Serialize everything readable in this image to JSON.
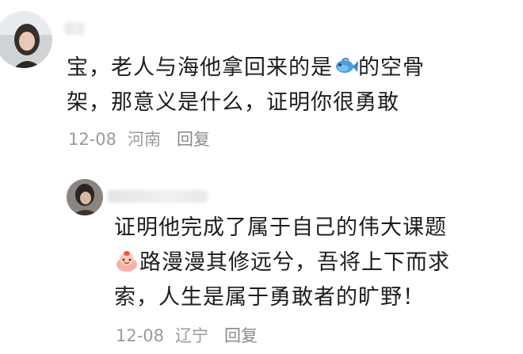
{
  "comments": [
    {
      "line1_before_emoji": "宝，老人与海他拿回来的是",
      "emoji": "fish-emoji",
      "line1_after_emoji": "的空骨",
      "line2": "架，那意义是什么，证明你很勇敢",
      "date": "12-08",
      "location": "河南",
      "reply_label": "回复"
    },
    {
      "line1": "证明他完成了属于自己的伟大课题",
      "emoji": "mochi-emoji",
      "line2_after_emoji": "路漫漫其修远兮，吾将上下而求",
      "line3": "索，人生是属于勇敢者的旷野！",
      "date": "12-08",
      "location": "辽宁",
      "reply_label": "回复"
    }
  ]
}
